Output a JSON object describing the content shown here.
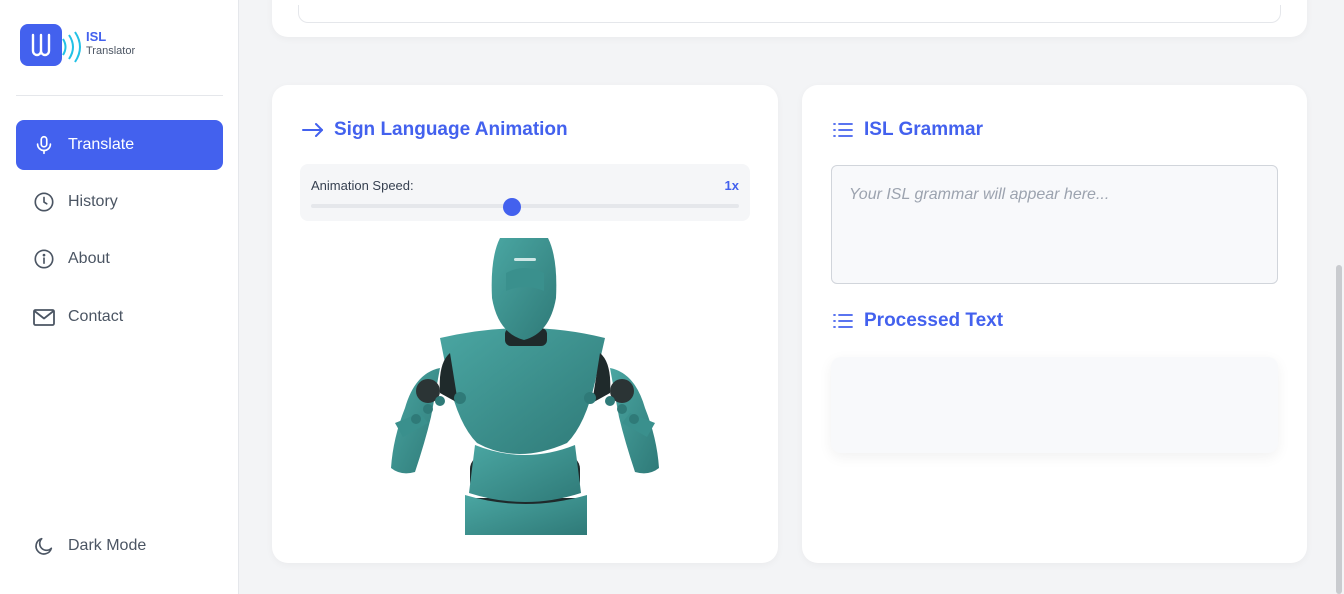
{
  "brand": {
    "title": "ISL",
    "subtitle": "Translator"
  },
  "sidebar": {
    "items": [
      {
        "label": "Translate",
        "icon": "microphone-icon",
        "active": true
      },
      {
        "label": "History",
        "icon": "clock-icon"
      },
      {
        "label": "About",
        "icon": "info-icon"
      },
      {
        "label": "Contact",
        "icon": "mail-icon"
      }
    ],
    "dark_mode": {
      "label": "Dark Mode",
      "icon": "moon-icon"
    }
  },
  "animation": {
    "title": "Sign Language Animation",
    "speed_label": "Animation Speed:",
    "speed_value": "1x",
    "speed_fraction": 0.47
  },
  "grammar": {
    "title": "ISL Grammar",
    "placeholder": "Your ISL grammar will appear here...",
    "processed_title": "Processed Text",
    "processed_value": ""
  },
  "colors": {
    "accent": "#4361ee",
    "avatar": "#3f8f8c"
  }
}
